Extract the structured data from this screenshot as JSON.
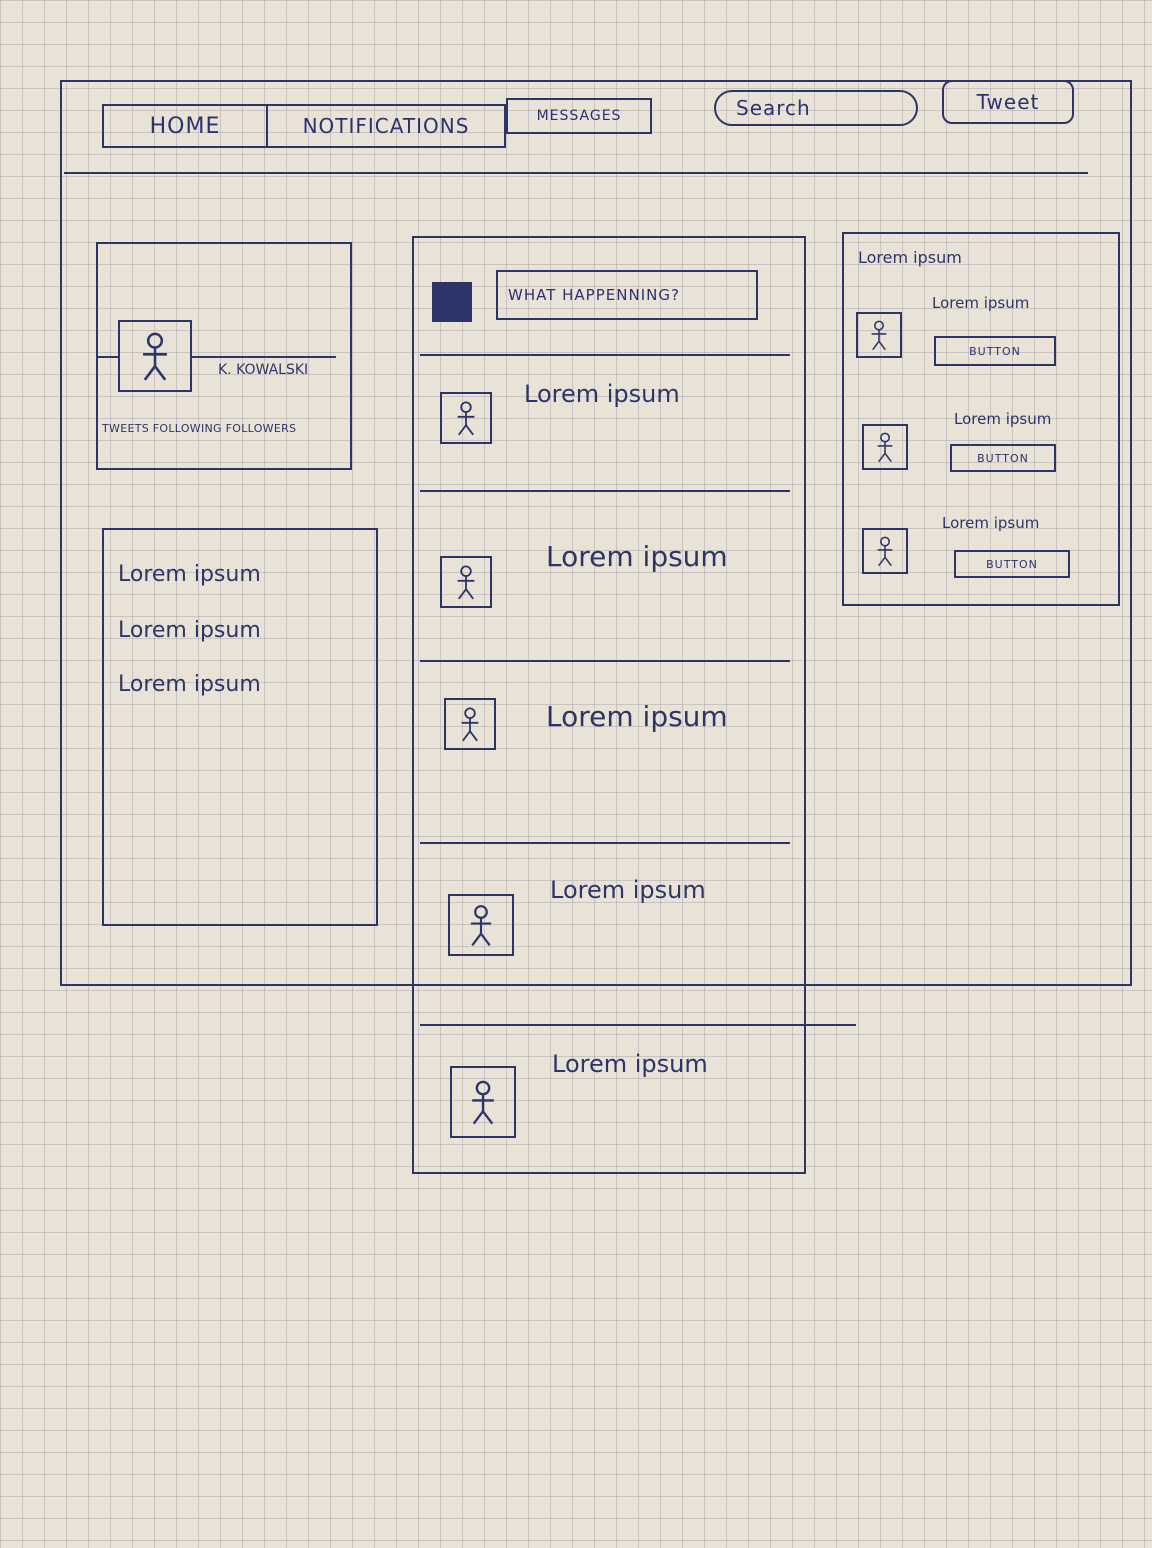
{
  "nav": {
    "home": "HOME",
    "notifications": "NOTIFICATIONS",
    "messages": "MESSAGES",
    "search_placeholder": "Search",
    "tweet": "Tweet"
  },
  "profile": {
    "name": "K. KOWALSKI",
    "stats": "TWEETS FOLLOWING FOLLOWERS"
  },
  "left_list": [
    "Lorem ipsum",
    "Lorem ipsum",
    "Lorem ipsum"
  ],
  "compose": {
    "placeholder": "WHAT HAPPENNING?"
  },
  "feed": [
    "Lorem ipsum",
    "Lorem ipsum",
    "Lorem ipsum",
    "Lorem ipsum",
    "Lorem ipsum"
  ],
  "suggestions": {
    "title": "Lorem ipsum",
    "items": [
      {
        "name": "Lorem ipsum",
        "button": "BUTTON"
      },
      {
        "name": "Lorem ipsum",
        "button": "BUTTON"
      },
      {
        "name": "Lorem ipsum",
        "button": "BUTTON"
      }
    ]
  },
  "colors": {
    "ink": "#2d3568",
    "paper": "#e9e2d6"
  }
}
